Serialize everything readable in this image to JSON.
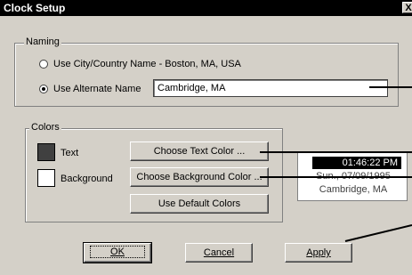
{
  "dialog": {
    "title": "Clock Setup",
    "close_glyph": "X"
  },
  "naming": {
    "legend": "Naming",
    "option_city": "Use City/Country Name - Boston, MA, USA",
    "option_alternate": "Use Alternate Name",
    "alternate_value": "Cambridge, MA",
    "selected": "alternate"
  },
  "colors": {
    "legend": "Colors",
    "text_label": "Text",
    "background_label": "Background",
    "text_swatch_color": "#404040",
    "background_swatch_color": "#ffffff",
    "choose_text_button": "Choose Text Color ...",
    "choose_background_button": "Choose Background Color ...",
    "default_colors_button": "Use Default Colors"
  },
  "preview": {
    "time": "01:46:22 PM",
    "date": "Sun., 07/09/1995",
    "city": "Cambridge, MA"
  },
  "buttons": {
    "ok": "OK",
    "cancel": "Cancel",
    "apply": "Apply"
  }
}
